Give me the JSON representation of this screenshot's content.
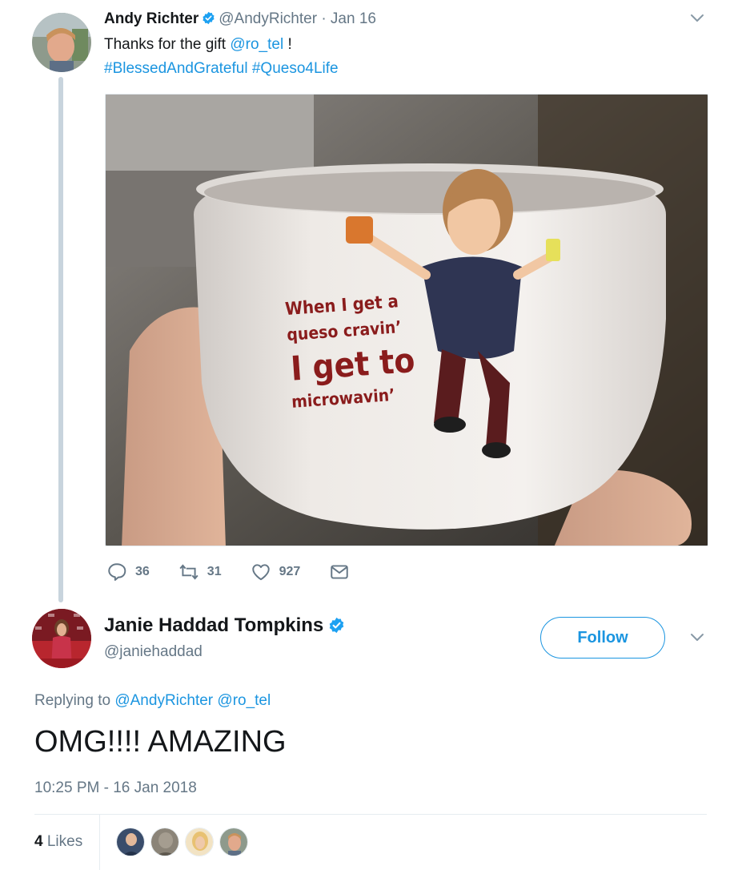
{
  "parent_tweet": {
    "name": "Andy Richter",
    "handle": "@AndyRichter",
    "separator": "·",
    "date": "Jan 16",
    "text_prefix": "Thanks for the gift ",
    "mention": "@ro_tel",
    "text_suffix": " !",
    "hashtags": [
      "#BlessedAndGrateful",
      "#Queso4Life"
    ],
    "image_text": {
      "line1": "When I get a",
      "line2": "queso cravin’",
      "line3": "I get to",
      "line4": "microwavin’"
    },
    "actions": {
      "replies": "36",
      "retweets": "31",
      "likes": "927"
    }
  },
  "reply_tweet": {
    "name": "Janie Haddad Tompkins",
    "handle": "@janiehaddad",
    "follow_label": "Follow",
    "replying_prefix": "Replying to ",
    "replying_to": [
      "@AndyRichter",
      "@ro_tel"
    ],
    "text": "OMG!!!! AMAZING",
    "timestamp": "10:25 PM - 16 Jan 2018",
    "likes_count": "4",
    "likes_label": "Likes"
  },
  "colors": {
    "link": "#1b95e0",
    "muted": "#657786",
    "text": "#14171a",
    "thread_line": "#c8d4dd",
    "verified": "#1da1f2",
    "like_icon": "#657786"
  },
  "icons": [
    "verified-badge-icon",
    "chevron-down-icon",
    "reply-icon",
    "retweet-icon",
    "like-icon",
    "direct-message-icon"
  ]
}
